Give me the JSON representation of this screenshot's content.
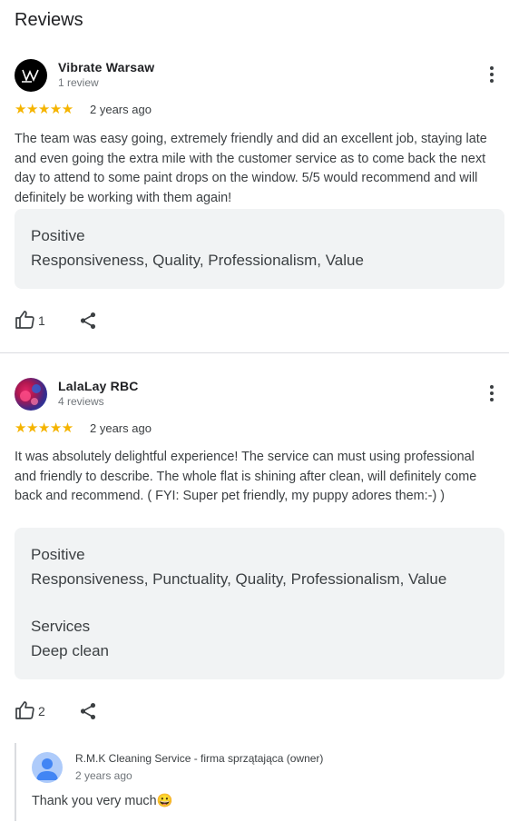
{
  "section_title": "Reviews",
  "reviews": [
    {
      "author": "Vibrate Warsaw",
      "review_count": "1 review",
      "rating": 5,
      "stars": "★★★★★",
      "date": "2 years ago",
      "text": "The team was easy going, extremely friendly and did an excellent job, staying late and even going the extra mile with the customer service as to come back the next day to attend to some paint drops on the window. 5/5 would recommend and will definitely be working with them again!",
      "tags": [
        {
          "label": "Positive",
          "value": "Responsiveness, Quality, Professionalism, Value"
        }
      ],
      "likes": "1",
      "avatar_color": "#000000"
    },
    {
      "author": "LalaLay RBC",
      "review_count": "4 reviews",
      "rating": 5,
      "stars": "★★★★★",
      "date": "2 years ago",
      "text": "It was absolutely delightful experience! The service can must using professional and friendly to describe. The whole flat is shining after clean, will definitely come back and recommend. ( FYI: Super pet friendly, my puppy adores them:-) )",
      "tags": [
        {
          "label": "Positive",
          "value": "Responsiveness, Punctuality, Quality, Professionalism, Value"
        },
        {
          "label": "Services",
          "value": "Deep clean"
        }
      ],
      "likes": "2",
      "owner_reply": {
        "name": "R.M.K Cleaning Service - firma sprzątająca (owner)",
        "date": "2 years ago",
        "text": "Thank you very much😀"
      }
    }
  ],
  "colors": {
    "star": "#f5b400",
    "tag_bg": "#f1f3f4",
    "divider": "#dadce0"
  },
  "icons": [
    "more-vert-icon",
    "thumb-up-icon",
    "share-icon",
    "person-icon",
    "star-icon"
  ]
}
